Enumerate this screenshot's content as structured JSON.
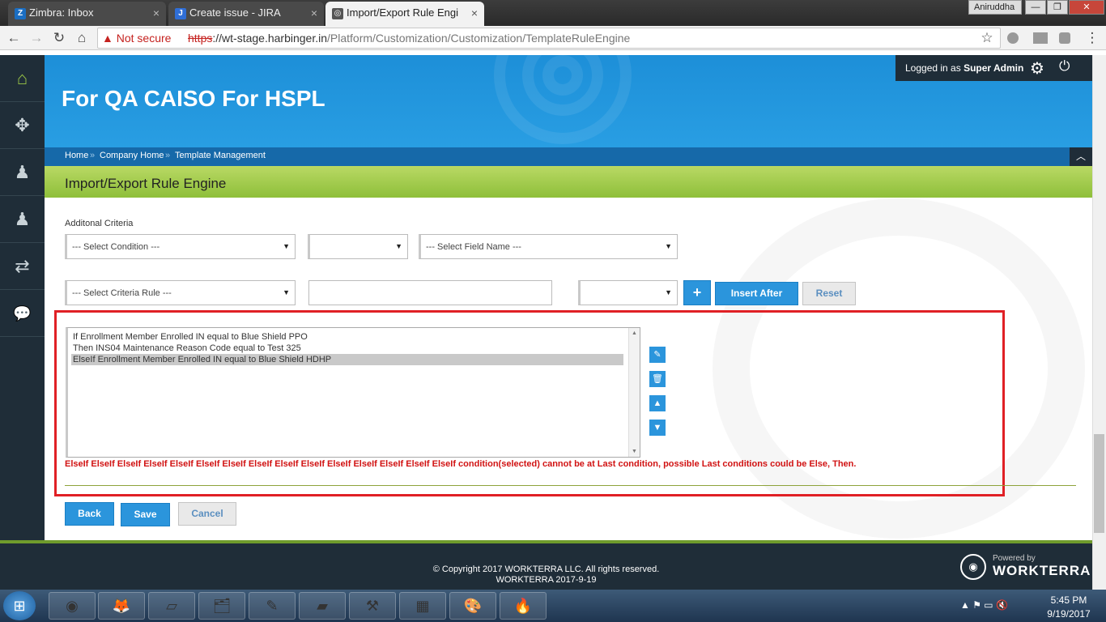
{
  "browser": {
    "tabs": [
      {
        "label": "Zimbra: Inbox",
        "icon": "Z",
        "close": "×"
      },
      {
        "label": "Create issue - JIRA",
        "icon": "J",
        "close": "×"
      },
      {
        "label": "Import/Export Rule Engi",
        "icon": "◎",
        "close": "×"
      }
    ],
    "user": "Aniruddha",
    "window_controls": {
      "minimize": "—",
      "maximize": "❐",
      "close": "✕"
    },
    "not_secure": "▲ Not secure",
    "url_scheme": "https",
    "url_host": "://wt-stage.harbinger.in",
    "url_path": "/Platform/Customization/Customization/TemplateRuleEngine",
    "bookmark_star": "☆",
    "nav": {
      "back": "←",
      "forward": "→",
      "reload": "↻",
      "home": "⌂",
      "menu": "⋮"
    }
  },
  "sidebar": {
    "items": [
      {
        "name": "home",
        "glyph": "⌂"
      },
      {
        "name": "modules",
        "glyph": "✥"
      },
      {
        "name": "user-star",
        "glyph": "♟"
      },
      {
        "name": "user",
        "glyph": "♟"
      },
      {
        "name": "transfer",
        "glyph": "⇄"
      },
      {
        "name": "chat",
        "glyph": "💬"
      }
    ]
  },
  "header": {
    "title": "For QA CAISO For HSPL",
    "login_prefix": "Logged in as ",
    "login_user": "Super Admin",
    "gear": "⚙",
    "power": "⏻",
    "breadcrumb": [
      "Home",
      "Company Home",
      "Template Management"
    ],
    "breadcrumb_sep": "»",
    "collapse": "︿"
  },
  "page": {
    "title": "Import/Export Rule Engine",
    "criteria_label": "Additonal Criteria"
  },
  "form": {
    "select_condition": "--- Select Condition ---",
    "select_operator": "",
    "select_field_name": "--- Select Field Name ---",
    "select_criteria_rule": "--- Select Criteria Rule ---",
    "criteria_value": "",
    "select_connector": "",
    "caret": "▼",
    "add_label": "+",
    "insert_after_label": "Insert After",
    "reset_label": "Reset"
  },
  "rules": {
    "items": [
      {
        "text": "If Enrollment Member Enrolled IN equal to Blue Shield PPO",
        "selected": false
      },
      {
        "text": "Then INS04 Maintenance Reason Code equal to Test 325",
        "selected": false
      },
      {
        "text": "ElseIf Enrollment Member Enrolled IN equal to Blue Shield HDHP",
        "selected": true
      }
    ],
    "scroll_up": "▲",
    "scroll_down": "▼",
    "edit_icon": "✎",
    "delete_icon": "🗑",
    "up_icon": "▲",
    "down_icon": "▼"
  },
  "error_message": "ElseIf ElseIf ElseIf ElseIf ElseIf ElseIf ElseIf ElseIf ElseIf ElseIf ElseIf ElseIf ElseIf ElseIf ElseIf condition(selected) cannot be at Last condition, possible Last conditions could be Else, Then.",
  "actions": {
    "back_label": "Back",
    "save_label": "Save",
    "cancel_label": "Cancel"
  },
  "footer": {
    "copyright": "© Copyright 2017 WORKTERRA LLC. All rights reserved.",
    "version": "WORKTERRA 2017-9-19",
    "powered_by": "Powered by",
    "brand": "WORKTERRA"
  },
  "taskbar": {
    "start": "⊞",
    "apps": [
      {
        "name": "chrome",
        "glyph": "◉"
      },
      {
        "name": "firefox",
        "glyph": "🦊"
      },
      {
        "name": "sticky-notes",
        "glyph": "▱"
      },
      {
        "name": "file-explorer",
        "glyph": "🗂"
      },
      {
        "name": "notepad-plus",
        "glyph": "✎"
      },
      {
        "name": "eraser-app",
        "glyph": "▰"
      },
      {
        "name": "tools-app",
        "glyph": "⚒"
      },
      {
        "name": "spreadsheet-app",
        "glyph": "▦"
      },
      {
        "name": "paint",
        "glyph": "🎨"
      },
      {
        "name": "flame-app",
        "glyph": "🔥"
      }
    ],
    "tray": "▲ ⚑ ▭ 🔇",
    "time": "5:45 PM",
    "date": "9/19/2017"
  },
  "colors": {
    "header_blue": "#2299e0",
    "breadcrumb_blue": "#1669a9",
    "sidebar_dark": "#1f2d38",
    "title_green": "#9cc846",
    "button_blue": "#2b95dc",
    "error_red": "#d11212",
    "frame_red": "#e02025"
  }
}
